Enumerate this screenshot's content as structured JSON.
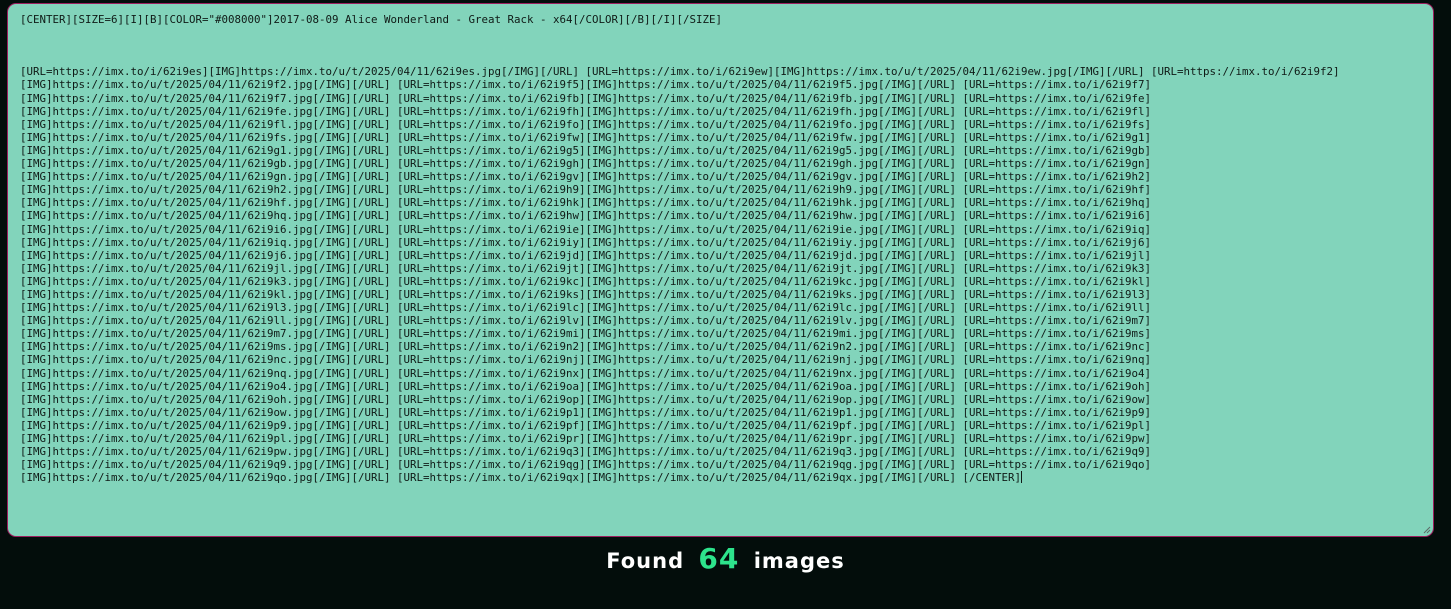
{
  "editor": {
    "lines": [
      "[CENTER][SIZE=6][I][B][COLOR=\"#008000\"]2017-08-09 Alice Wonderland - Great Rack - x64[/COLOR][/B][/I][/SIZE]",
      "",
      "",
      "",
      "[URL=https://imx.to/i/62i9es][IMG]https://imx.to/u/t/2025/04/11/62i9es.jpg[/IMG][/URL] [URL=https://imx.to/i/62i9ew][IMG]https://imx.to/u/t/2025/04/11/62i9ew.jpg[/IMG][/URL] [URL=https://imx.to/i/62i9f2]",
      "[IMG]https://imx.to/u/t/2025/04/11/62i9f2.jpg[/IMG][/URL] [URL=https://imx.to/i/62i9f5][IMG]https://imx.to/u/t/2025/04/11/62i9f5.jpg[/IMG][/URL] [URL=https://imx.to/i/62i9f7]",
      "[IMG]https://imx.to/u/t/2025/04/11/62i9f7.jpg[/IMG][/URL] [URL=https://imx.to/i/62i9fb][IMG]https://imx.to/u/t/2025/04/11/62i9fb.jpg[/IMG][/URL] [URL=https://imx.to/i/62i9fe]",
      "[IMG]https://imx.to/u/t/2025/04/11/62i9fe.jpg[/IMG][/URL] [URL=https://imx.to/i/62i9fh][IMG]https://imx.to/u/t/2025/04/11/62i9fh.jpg[/IMG][/URL] [URL=https://imx.to/i/62i9fl]",
      "[IMG]https://imx.to/u/t/2025/04/11/62i9fl.jpg[/IMG][/URL] [URL=https://imx.to/i/62i9fo][IMG]https://imx.to/u/t/2025/04/11/62i9fo.jpg[/IMG][/URL] [URL=https://imx.to/i/62i9fs]",
      "[IMG]https://imx.to/u/t/2025/04/11/62i9fs.jpg[/IMG][/URL] [URL=https://imx.to/i/62i9fw][IMG]https://imx.to/u/t/2025/04/11/62i9fw.jpg[/IMG][/URL] [URL=https://imx.to/i/62i9g1]",
      "[IMG]https://imx.to/u/t/2025/04/11/62i9g1.jpg[/IMG][/URL] [URL=https://imx.to/i/62i9g5][IMG]https://imx.to/u/t/2025/04/11/62i9g5.jpg[/IMG][/URL] [URL=https://imx.to/i/62i9gb]",
      "[IMG]https://imx.to/u/t/2025/04/11/62i9gb.jpg[/IMG][/URL] [URL=https://imx.to/i/62i9gh][IMG]https://imx.to/u/t/2025/04/11/62i9gh.jpg[/IMG][/URL] [URL=https://imx.to/i/62i9gn]",
      "[IMG]https://imx.to/u/t/2025/04/11/62i9gn.jpg[/IMG][/URL] [URL=https://imx.to/i/62i9gv][IMG]https://imx.to/u/t/2025/04/11/62i9gv.jpg[/IMG][/URL] [URL=https://imx.to/i/62i9h2]",
      "[IMG]https://imx.to/u/t/2025/04/11/62i9h2.jpg[/IMG][/URL] [URL=https://imx.to/i/62i9h9][IMG]https://imx.to/u/t/2025/04/11/62i9h9.jpg[/IMG][/URL] [URL=https://imx.to/i/62i9hf]",
      "[IMG]https://imx.to/u/t/2025/04/11/62i9hf.jpg[/IMG][/URL] [URL=https://imx.to/i/62i9hk][IMG]https://imx.to/u/t/2025/04/11/62i9hk.jpg[/IMG][/URL] [URL=https://imx.to/i/62i9hq]",
      "[IMG]https://imx.to/u/t/2025/04/11/62i9hq.jpg[/IMG][/URL] [URL=https://imx.to/i/62i9hw][IMG]https://imx.to/u/t/2025/04/11/62i9hw.jpg[/IMG][/URL] [URL=https://imx.to/i/62i9i6]",
      "[IMG]https://imx.to/u/t/2025/04/11/62i9i6.jpg[/IMG][/URL] [URL=https://imx.to/i/62i9ie][IMG]https://imx.to/u/t/2025/04/11/62i9ie.jpg[/IMG][/URL] [URL=https://imx.to/i/62i9iq]",
      "[IMG]https://imx.to/u/t/2025/04/11/62i9iq.jpg[/IMG][/URL] [URL=https://imx.to/i/62i9iy][IMG]https://imx.to/u/t/2025/04/11/62i9iy.jpg[/IMG][/URL] [URL=https://imx.to/i/62i9j6]",
      "[IMG]https://imx.to/u/t/2025/04/11/62i9j6.jpg[/IMG][/URL] [URL=https://imx.to/i/62i9jd][IMG]https://imx.to/u/t/2025/04/11/62i9jd.jpg[/IMG][/URL] [URL=https://imx.to/i/62i9jl]",
      "[IMG]https://imx.to/u/t/2025/04/11/62i9jl.jpg[/IMG][/URL] [URL=https://imx.to/i/62i9jt][IMG]https://imx.to/u/t/2025/04/11/62i9jt.jpg[/IMG][/URL] [URL=https://imx.to/i/62i9k3]",
      "[IMG]https://imx.to/u/t/2025/04/11/62i9k3.jpg[/IMG][/URL] [URL=https://imx.to/i/62i9kc][IMG]https://imx.to/u/t/2025/04/11/62i9kc.jpg[/IMG][/URL] [URL=https://imx.to/i/62i9kl]",
      "[IMG]https://imx.to/u/t/2025/04/11/62i9kl.jpg[/IMG][/URL] [URL=https://imx.to/i/62i9ks][IMG]https://imx.to/u/t/2025/04/11/62i9ks.jpg[/IMG][/URL] [URL=https://imx.to/i/62i9l3]",
      "[IMG]https://imx.to/u/t/2025/04/11/62i9l3.jpg[/IMG][/URL] [URL=https://imx.to/i/62i9lc][IMG]https://imx.to/u/t/2025/04/11/62i9lc.jpg[/IMG][/URL] [URL=https://imx.to/i/62i9ll]",
      "[IMG]https://imx.to/u/t/2025/04/11/62i9ll.jpg[/IMG][/URL] [URL=https://imx.to/i/62i9lv][IMG]https://imx.to/u/t/2025/04/11/62i9lv.jpg[/IMG][/URL] [URL=https://imx.to/i/62i9m7]",
      "[IMG]https://imx.to/u/t/2025/04/11/62i9m7.jpg[/IMG][/URL] [URL=https://imx.to/i/62i9mi][IMG]https://imx.to/u/t/2025/04/11/62i9mi.jpg[/IMG][/URL] [URL=https://imx.to/i/62i9ms]",
      "[IMG]https://imx.to/u/t/2025/04/11/62i9ms.jpg[/IMG][/URL] [URL=https://imx.to/i/62i9n2][IMG]https://imx.to/u/t/2025/04/11/62i9n2.jpg[/IMG][/URL] [URL=https://imx.to/i/62i9nc]",
      "[IMG]https://imx.to/u/t/2025/04/11/62i9nc.jpg[/IMG][/URL] [URL=https://imx.to/i/62i9nj][IMG]https://imx.to/u/t/2025/04/11/62i9nj.jpg[/IMG][/URL] [URL=https://imx.to/i/62i9nq]",
      "[IMG]https://imx.to/u/t/2025/04/11/62i9nq.jpg[/IMG][/URL] [URL=https://imx.to/i/62i9nx][IMG]https://imx.to/u/t/2025/04/11/62i9nx.jpg[/IMG][/URL] [URL=https://imx.to/i/62i9o4]",
      "[IMG]https://imx.to/u/t/2025/04/11/62i9o4.jpg[/IMG][/URL] [URL=https://imx.to/i/62i9oa][IMG]https://imx.to/u/t/2025/04/11/62i9oa.jpg[/IMG][/URL] [URL=https://imx.to/i/62i9oh]",
      "[IMG]https://imx.to/u/t/2025/04/11/62i9oh.jpg[/IMG][/URL] [URL=https://imx.to/i/62i9op][IMG]https://imx.to/u/t/2025/04/11/62i9op.jpg[/IMG][/URL] [URL=https://imx.to/i/62i9ow]",
      "[IMG]https://imx.to/u/t/2025/04/11/62i9ow.jpg[/IMG][/URL] [URL=https://imx.to/i/62i9p1][IMG]https://imx.to/u/t/2025/04/11/62i9p1.jpg[/IMG][/URL] [URL=https://imx.to/i/62i9p9]",
      "[IMG]https://imx.to/u/t/2025/04/11/62i9p9.jpg[/IMG][/URL] [URL=https://imx.to/i/62i9pf][IMG]https://imx.to/u/t/2025/04/11/62i9pf.jpg[/IMG][/URL] [URL=https://imx.to/i/62i9pl]",
      "[IMG]https://imx.to/u/t/2025/04/11/62i9pl.jpg[/IMG][/URL] [URL=https://imx.to/i/62i9pr][IMG]https://imx.to/u/t/2025/04/11/62i9pr.jpg[/IMG][/URL] [URL=https://imx.to/i/62i9pw]",
      "[IMG]https://imx.to/u/t/2025/04/11/62i9pw.jpg[/IMG][/URL] [URL=https://imx.to/i/62i9q3][IMG]https://imx.to/u/t/2025/04/11/62i9q3.jpg[/IMG][/URL] [URL=https://imx.to/i/62i9q9]",
      "[IMG]https://imx.to/u/t/2025/04/11/62i9q9.jpg[/IMG][/URL] [URL=https://imx.to/i/62i9qg][IMG]https://imx.to/u/t/2025/04/11/62i9qg.jpg[/IMG][/URL] [URL=https://imx.to/i/62i9qo]",
      "[IMG]https://imx.to/u/t/2025/04/11/62i9qo.jpg[/IMG][/URL] [URL=https://imx.to/i/62i9qx][IMG]https://imx.to/u/t/2025/04/11/62i9qx.jpg[/IMG][/URL] [/CENTER]"
    ]
  },
  "footer": {
    "prefix": "Found",
    "count": "64",
    "suffix": "images"
  },
  "colors": {
    "page_background": "#030d0b",
    "editor_background": "#82d4bb",
    "editor_border": "#9b1f5e",
    "count_accent": "#2de38c",
    "footer_text": "#ffffff"
  }
}
